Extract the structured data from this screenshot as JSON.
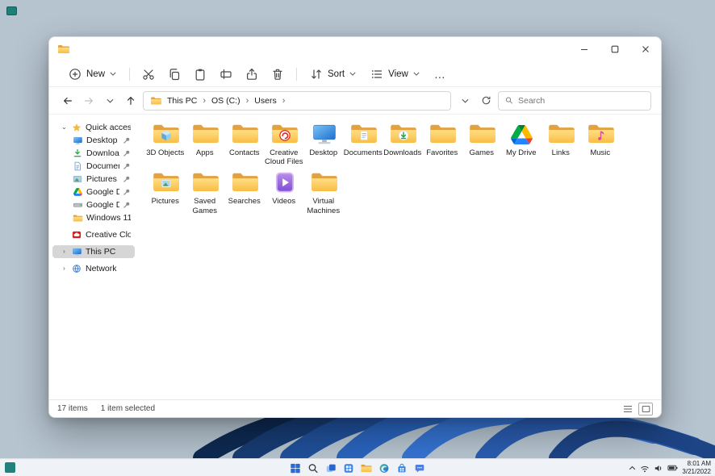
{
  "desktop": {
    "bg_color": "#b6c4d0"
  },
  "window": {
    "toolbar": {
      "new_label": "New",
      "sort_label": "Sort",
      "view_label": "View",
      "more_label": "…"
    },
    "address": {
      "breadcrumbs": [
        "This PC",
        "OS (C:)",
        "Users"
      ],
      "search_placeholder": "Search"
    },
    "sidebar": {
      "items": [
        {
          "label": "Quick access",
          "icon": "star-icon",
          "pinned": false
        },
        {
          "label": "Desktop",
          "icon": "monitor-icon",
          "pinned": true
        },
        {
          "label": "Downloads",
          "icon": "download-icon",
          "pinned": true
        },
        {
          "label": "Documents",
          "icon": "document-icon",
          "pinned": true
        },
        {
          "label": "Pictures",
          "icon": "picture-icon",
          "pinned": true
        },
        {
          "label": "Google Drive",
          "icon": "google-drive-icon",
          "pinned": true
        },
        {
          "label": "Google Drive (D:)",
          "icon": "hard-drive-icon",
          "pinned": true
        },
        {
          "label": "Windows 11",
          "icon": "folder-icon",
          "pinned": false
        },
        {
          "label": "Creative Cloud Files",
          "icon": "creative-cloud-icon",
          "pinned": false
        },
        {
          "label": "This PC",
          "icon": "computer-icon",
          "pinned": false,
          "selected": true
        },
        {
          "label": "Network",
          "icon": "network-icon",
          "pinned": false
        }
      ]
    },
    "files": [
      {
        "name": "3D Objects",
        "icon": "folder-3d-icon"
      },
      {
        "name": "Apps",
        "icon": "folder-icon"
      },
      {
        "name": "Contacts",
        "icon": "folder-icon"
      },
      {
        "name": "Creative Cloud Files",
        "icon": "folder-creative-cloud-icon"
      },
      {
        "name": "Desktop",
        "icon": "monitor-icon"
      },
      {
        "name": "Documents",
        "icon": "folder-documents-icon"
      },
      {
        "name": "Downloads",
        "icon": "folder-downloads-icon"
      },
      {
        "name": "Favorites",
        "icon": "folder-icon"
      },
      {
        "name": "Games",
        "icon": "folder-icon"
      },
      {
        "name": "My Drive",
        "icon": "google-drive-icon"
      },
      {
        "name": "Links",
        "icon": "folder-icon"
      },
      {
        "name": "Music",
        "icon": "folder-music-icon"
      },
      {
        "name": "Pictures",
        "icon": "folder-pictures-icon"
      },
      {
        "name": "Saved Games",
        "icon": "folder-icon"
      },
      {
        "name": "Searches",
        "icon": "folder-icon"
      },
      {
        "name": "Videos",
        "icon": "videos-icon"
      },
      {
        "name": "Virtual Machines",
        "icon": "folder-icon"
      }
    ],
    "status": {
      "items_count": "17 items",
      "selection": "1 item selected"
    }
  },
  "taskbar": {
    "icons": [
      "start",
      "search",
      "task-view",
      "widgets",
      "file-explorer",
      "edge",
      "store",
      "chat"
    ],
    "tray": {
      "time": "8:01 AM",
      "date": "3/21/2022"
    }
  }
}
